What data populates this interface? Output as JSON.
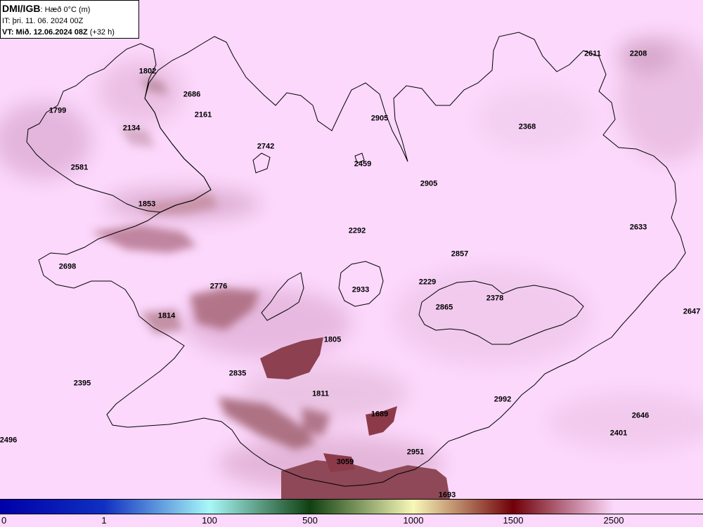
{
  "header": {
    "brand": "DMI/IGB",
    "title": ": Hæð 0°C (m)",
    "init_time": "IT: þri. 11. 06. 2024 00Z",
    "valid_time": "VT: Mið. 12.06.2024 08Z",
    "lead_time": " (+32 h)"
  },
  "map": {
    "field": "Hæð 0°C",
    "unit": "m",
    "background_color": "#fcd8fc",
    "coastline_color": "#000000",
    "values": [
      "1802",
      "2686",
      "2161",
      "1799",
      "2134",
      "2742",
      "2905",
      "2611",
      "2208",
      "2368",
      "2581",
      "2459",
      "2905",
      "1853",
      "2292",
      "2633",
      "2698",
      "2857",
      "2776",
      "2933",
      "2229",
      "2378",
      "2865",
      "2647",
      "1814",
      "1805",
      "2835",
      "2395",
      "1811",
      "2992",
      "1689",
      "2646",
      "2401",
      "2496",
      "2951",
      "3059",
      "1693"
    ]
  },
  "colorbar": {
    "tick_labels": [
      "0",
      "1",
      "100",
      "500",
      "1000",
      "1500",
      "2500"
    ],
    "stops": [
      {
        "value": "0",
        "color": "#0000a8"
      },
      {
        "value": "1",
        "color": "#1030c0"
      },
      {
        "value": "100",
        "color": "#a8f8f8"
      },
      {
        "value": "500",
        "color": "#104010"
      },
      {
        "value": "1000",
        "color": "#f8f8b8"
      },
      {
        "value": "1500",
        "color": "#700008"
      },
      {
        "value": "2500",
        "color": "#fcd8fc"
      }
    ]
  }
}
